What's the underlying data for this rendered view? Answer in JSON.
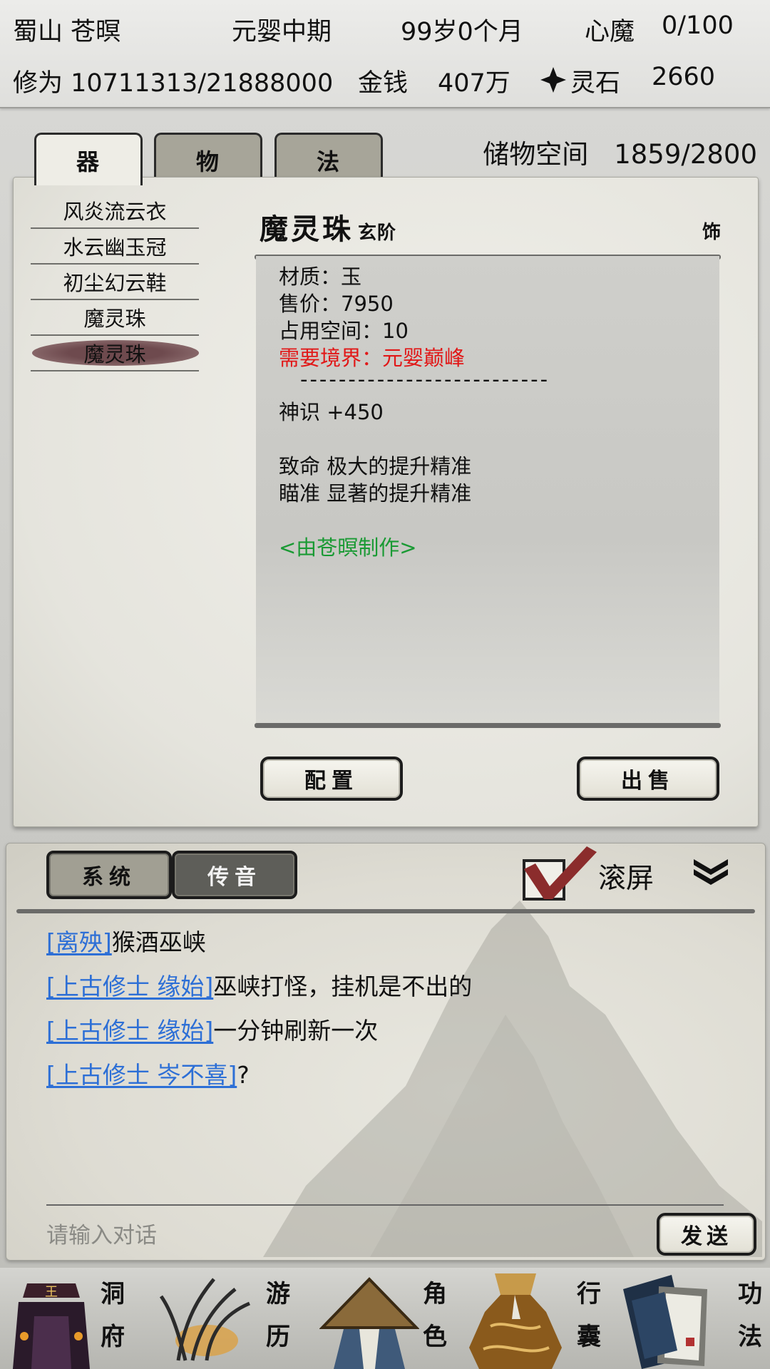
{
  "status": {
    "sect_name": "蜀山 苍暝",
    "realm": "元婴中期",
    "age": "99岁0个月",
    "demon_label": "心魔",
    "demon_value": "0/100",
    "cultivation": "修为 10711313/21888000",
    "money_label": "金钱",
    "money_value": "407万",
    "spirit_stone_label": "灵石",
    "spirit_stone_value": "2660"
  },
  "inventory": {
    "tabs": [
      "器",
      "物",
      "法"
    ],
    "active_tab": 0,
    "capacity_label": "储物空间",
    "capacity_value": "1859/2800",
    "items": [
      "风炎流云衣",
      "水云幽玉冠",
      "初尘幻云鞋",
      "魔灵珠",
      "魔灵珠"
    ],
    "selected_index": 4
  },
  "detail": {
    "name": "魔灵珠",
    "grade": "玄阶",
    "slot": "饰",
    "material": "材质：玉",
    "price": "售价：7950",
    "space": "占用空间：10",
    "requirement": "需要境界：元婴巅峰",
    "separator": "--------------------------",
    "stat": "神识 +450",
    "effect1": "致命 极大的提升精准",
    "effect2": "瞄准 显著的提升精准",
    "maker": "<由苍暝制作>",
    "equip_button": "配置",
    "sell_button": "出售",
    "colors": {
      "requirement": "#e11818",
      "maker": "#1a9a34"
    }
  },
  "chat": {
    "tabs": [
      "系统",
      "传音"
    ],
    "active_tab": 1,
    "scroll_label": "滚屏",
    "scroll_checked": true,
    "messages": [
      {
        "sender": "[离殃]",
        "text": "猴酒巫峡"
      },
      {
        "sender": "[上古修士 缘始]",
        "text": "巫峡打怪，挂机是不出的"
      },
      {
        "sender": "[上古修士 缘始]",
        "text": "一分钟刷新一次"
      },
      {
        "sender": "[上古修士 岑不喜]",
        "text": "?"
      }
    ],
    "input_placeholder": "请输入对话",
    "send_button": "发送",
    "colors": {
      "sender": "#2d6fd6"
    }
  },
  "nav": {
    "items": [
      {
        "line1": "洞",
        "line2": "府",
        "icon": "cave-dwelling-icon"
      },
      {
        "line1": "游",
        "line2": "历",
        "icon": "herb-travel-icon"
      },
      {
        "line1": "角",
        "line2": "色",
        "icon": "straw-hat-character-icon"
      },
      {
        "line1": "行",
        "line2": "囊",
        "icon": "treasure-bag-icon"
      },
      {
        "line1": "功",
        "line2": "法",
        "icon": "scripture-books-icon"
      }
    ]
  }
}
